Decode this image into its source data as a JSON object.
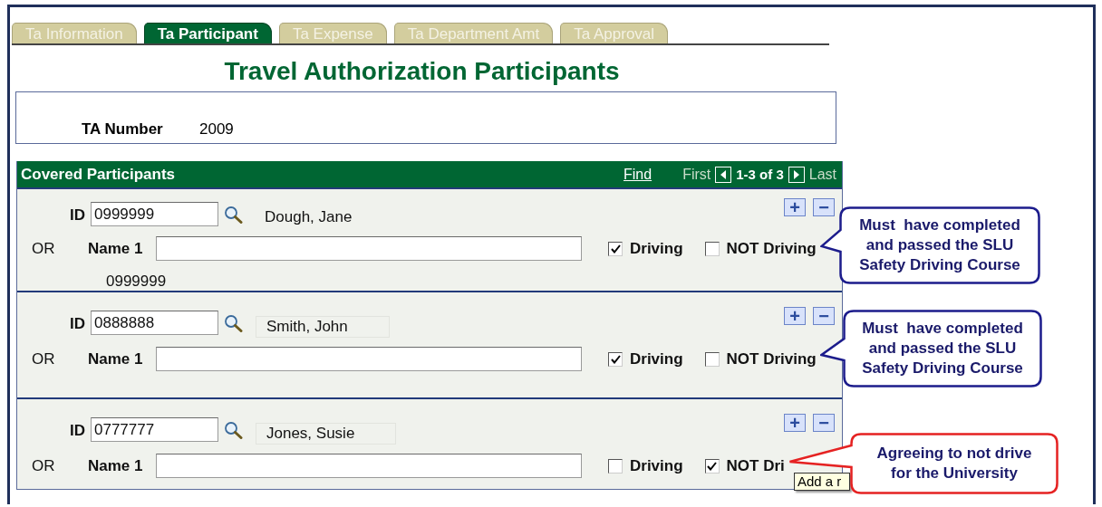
{
  "tabs": [
    {
      "label": "Ta Information",
      "selected": false
    },
    {
      "label": "Ta Participant",
      "selected": true
    },
    {
      "label": "Ta Expense",
      "selected": false
    },
    {
      "label": "Ta Department Amt",
      "selected": false
    },
    {
      "label": "Ta Approval",
      "selected": false
    }
  ],
  "title": "Travel Authorization Participants",
  "ta_number": {
    "label": "TA Number",
    "value": "2009"
  },
  "grid": {
    "title": "Covered Participants",
    "find": "Find",
    "first": "First",
    "range": "1-3 of 3",
    "last": "Last",
    "rows": [
      {
        "id_label": "ID",
        "id_value": "0999999",
        "name_display": "Dough, Jane",
        "boxed": false,
        "or_label": "OR",
        "name_label": "Name 1",
        "driving": {
          "label": "Driving",
          "checked": true
        },
        "not_driving": {
          "label": "NOT Driving",
          "checked": false
        },
        "note": "0999999",
        "add": "+",
        "remove": "−"
      },
      {
        "id_label": "ID",
        "id_value": "0888888",
        "name_display": "Smith, John",
        "boxed": true,
        "or_label": "OR",
        "name_label": "Name 1",
        "driving": {
          "label": "Driving",
          "checked": true
        },
        "not_driving": {
          "label": "NOT Driving",
          "checked": false
        },
        "add": "+",
        "remove": "−"
      },
      {
        "id_label": "ID",
        "id_value": "0777777",
        "name_display": "Jones, Susie",
        "boxed": true,
        "or_label": "OR",
        "name_label": "Name 1",
        "driving": {
          "label": "Driving",
          "checked": false
        },
        "not_driving": {
          "label": "NOT Dri",
          "checked": true
        },
        "add": "+",
        "remove": "−"
      }
    ]
  },
  "tooltip": "Add a r",
  "callouts": [
    {
      "text": "Must  have completed\nand passed the SLU\nSafety Driving Course",
      "color": "#1c1c8c"
    },
    {
      "text": "Must  have completed\nand passed the SLU\nSafety Driving Course",
      "color": "#1c1c8c"
    },
    {
      "text": "Agreeing to not drive\nfor the University",
      "color": "#e52222"
    }
  ]
}
